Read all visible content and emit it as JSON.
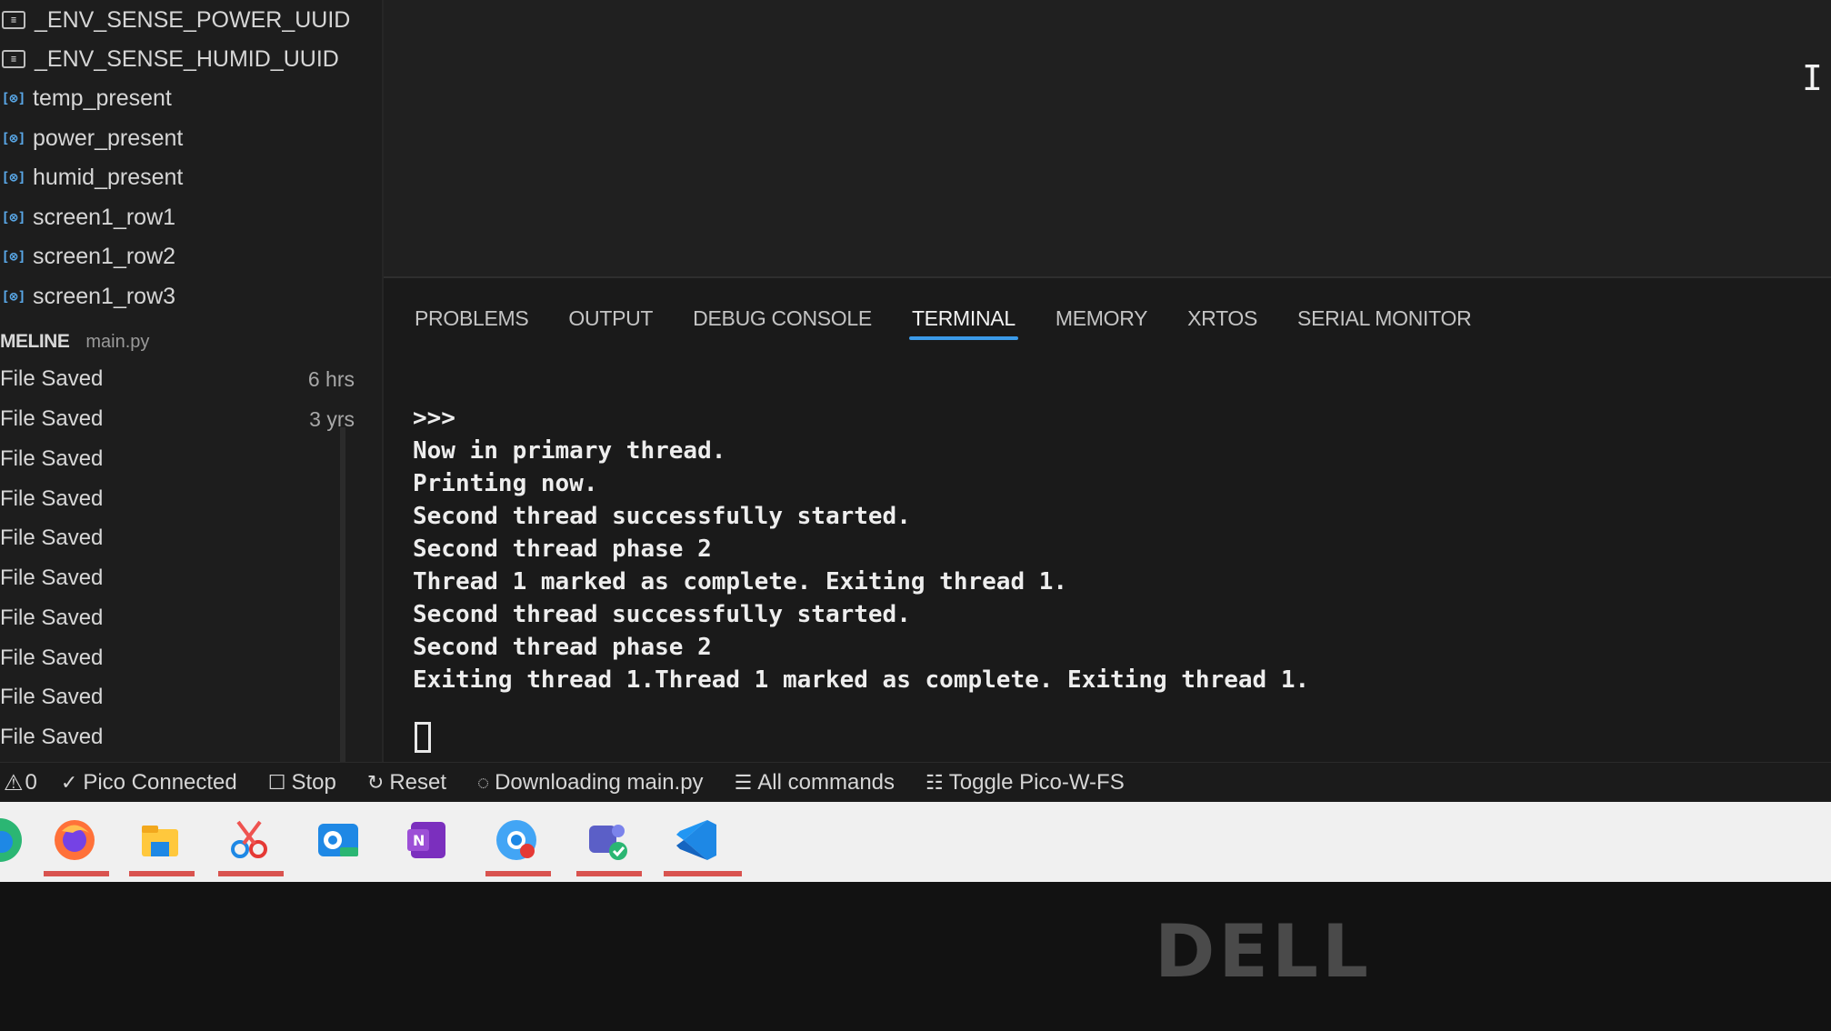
{
  "outline": {
    "items": [
      {
        "label": "_ENV_SENSE_POWER_UUID",
        "kind": "constant"
      },
      {
        "label": "_ENV_SENSE_HUMID_UUID",
        "kind": "constant"
      },
      {
        "label": "temp_present",
        "kind": "variable"
      },
      {
        "label": "power_present",
        "kind": "variable"
      },
      {
        "label": "humid_present",
        "kind": "variable"
      },
      {
        "label": "screen1_row1",
        "kind": "variable"
      },
      {
        "label": "screen1_row2",
        "kind": "variable"
      },
      {
        "label": "screen1_row3",
        "kind": "variable"
      }
    ]
  },
  "timeline": {
    "title": "MELINE",
    "file": "main.py",
    "rows": [
      {
        "label": "File Saved",
        "when": "6 hrs"
      },
      {
        "label": "File Saved",
        "when": "3 yrs"
      },
      {
        "label": "File Saved",
        "when": ""
      },
      {
        "label": "File Saved",
        "when": ""
      },
      {
        "label": "File Saved",
        "when": ""
      },
      {
        "label": "File Saved",
        "when": ""
      },
      {
        "label": "File Saved",
        "when": ""
      },
      {
        "label": "File Saved",
        "when": ""
      },
      {
        "label": "File Saved",
        "when": ""
      },
      {
        "label": "File Saved",
        "when": ""
      }
    ]
  },
  "panel": {
    "tabs": [
      "PROBLEMS",
      "OUTPUT",
      "DEBUG CONSOLE",
      "TERMINAL",
      "MEMORY",
      "XRTOS",
      "SERIAL MONITOR"
    ],
    "active_tab": "TERMINAL"
  },
  "terminal": {
    "lines": [
      ">>>",
      "Now in primary thread.",
      "Printing now.",
      "Second thread successfully started.",
      "Second thread phase 2",
      "Thread 1 marked as complete. Exiting thread 1.",
      "Second thread successfully started.",
      "Second thread phase 2",
      "Exiting thread 1.Thread 1 marked as complete. Exiting thread 1."
    ]
  },
  "statusbar": {
    "errors": "0",
    "connection": "Pico Connected",
    "stop": "Stop",
    "reset": "Reset",
    "download": "Downloading main.py",
    "all_commands": "All commands",
    "toggle_fs": "Toggle Pico-W-FS"
  },
  "taskbar": {
    "apps": [
      "edge-icon",
      "firefox-icon",
      "file-explorer-icon",
      "snipping-tool-icon",
      "outlook-icon",
      "onenote-icon",
      "chrome-icon",
      "teams-icon",
      "vscode-icon"
    ]
  },
  "bezel": {
    "logo": "DELL"
  },
  "colors": {
    "accent": "#3b9ae8",
    "taskbar_indicator": "#d9534f",
    "terminal_text": "#ededed"
  }
}
